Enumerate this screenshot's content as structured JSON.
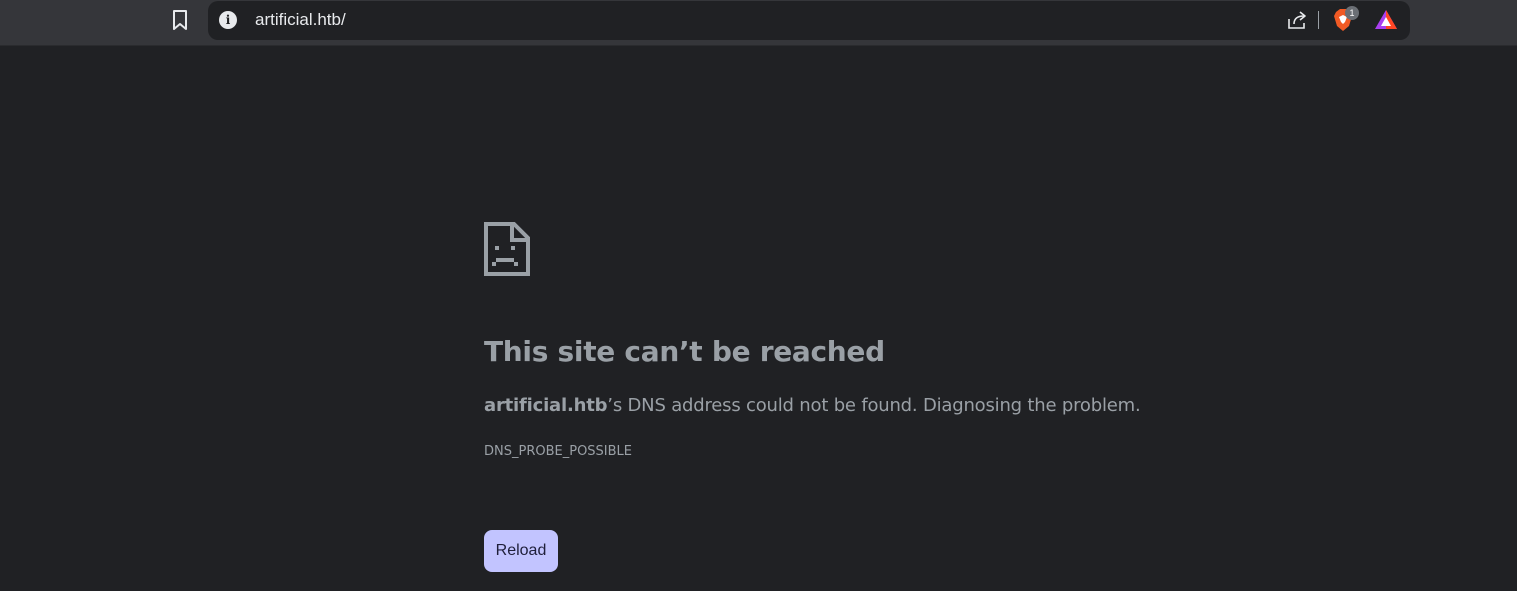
{
  "toolbar": {
    "bookmark_icon": "bookmark-icon",
    "site_info_icon": "info-icon",
    "site_info_glyph": "i",
    "url": "artificial.htb/",
    "share_icon": "share-icon",
    "shields_icon": "brave-shields-icon",
    "shields_count": "1",
    "rewards_icon": "brave-rewards-icon"
  },
  "error_page": {
    "icon": "sad-document-icon",
    "headline": "This site can’t be reached",
    "host": "artificial.htb",
    "description_rest": "’s DNS address could not be found. Diagnosing the problem.",
    "error_code": "DNS_PROBE_POSSIBLE",
    "reload_label": "Reload"
  },
  "colors": {
    "page_background": "#202124",
    "toolbar_background": "#35363a",
    "text": "#9aa0a6",
    "reload_button": "#c2c4ff"
  }
}
